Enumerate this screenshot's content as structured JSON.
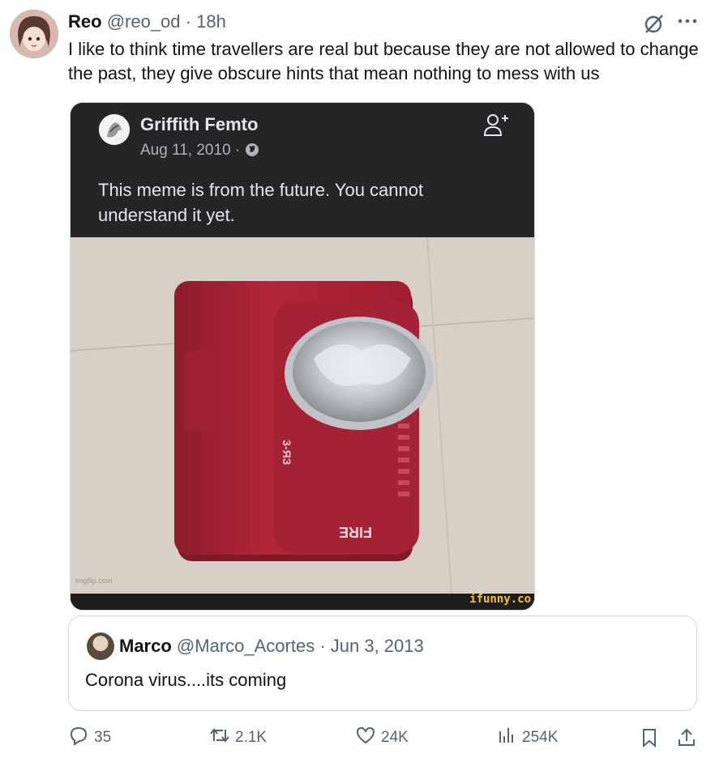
{
  "tweet": {
    "author_name": "Reo",
    "author_handle": "@reo_od",
    "separator": " · ",
    "time": "18h",
    "text": "I like to think time travellers are real but because they are not allowed to change the past, they give obscure hints that mean nothing to mess with us"
  },
  "embedded_post": {
    "name": "Griffith Femto",
    "date": "Aug 11, 2010 · ",
    "text": "This meme is from the future. You cannot understand it yet.",
    "photo_text_side": "FIRE",
    "photo_text_rotated": "3-ЯЗ",
    "watermark_left": "imgflip.com",
    "watermark_right": "ifunny.co"
  },
  "quote": {
    "name": "Marco",
    "handle": "@Marco_Acortes",
    "separator": " · ",
    "date": "Jun 3, 2013",
    "text": "Corona virus....its coming"
  },
  "actions": {
    "replies": "35",
    "reposts": "2.1K",
    "likes": "24K",
    "views": "254K"
  },
  "icons": [
    "grok-icon",
    "more-icon",
    "reply-icon",
    "repost-icon",
    "like-icon",
    "views-icon",
    "bookmark-icon",
    "share-icon",
    "globe-icon",
    "add-friend-icon"
  ]
}
